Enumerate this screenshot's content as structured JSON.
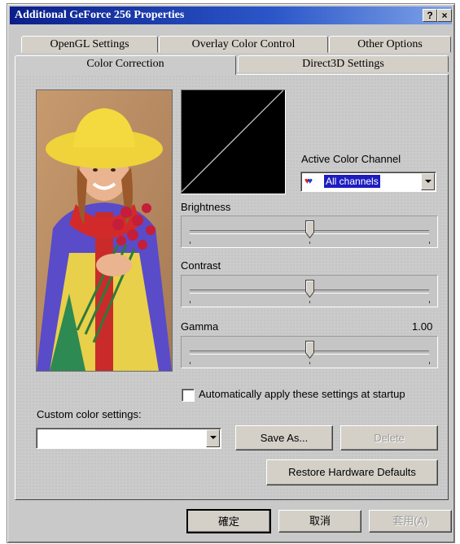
{
  "window": {
    "title": "Additional GeForce 256 Properties",
    "help_label": "?",
    "close_label": "×"
  },
  "tabs_back": [
    "OpenGL Settings",
    "Overlay Color Control",
    "Other Options"
  ],
  "tabs_front": [
    "Color Correction",
    "Direct3D Settings"
  ],
  "active_tab": "Color Correction",
  "color": {
    "active_channel_label": "Active Color Channel",
    "channel_value": "All channels",
    "brightness_label": "Brightness",
    "brightness_level": 0.5,
    "contrast_label": "Contrast",
    "contrast_level": 0.5,
    "gamma_label": "Gamma",
    "gamma_value": "1.00",
    "gamma_level": 0.5,
    "auto_apply_label": "Automatically apply these settings at startup",
    "auto_apply_checked": false,
    "custom_label": "Custom color settings:",
    "custom_value": "",
    "save_as_label": "Save As...",
    "delete_label": "Delete",
    "restore_label": "Restore Hardware Defaults"
  },
  "footer": {
    "ok_label": "確定",
    "cancel_label": "取消",
    "apply_label": "套用(A)"
  },
  "icons": {
    "channel_icon": "rgb-hearts-icon"
  },
  "colors": {
    "title_start": "#0a1e8a",
    "title_end": "#7fa3e8",
    "selection": "#1d1dbf"
  }
}
